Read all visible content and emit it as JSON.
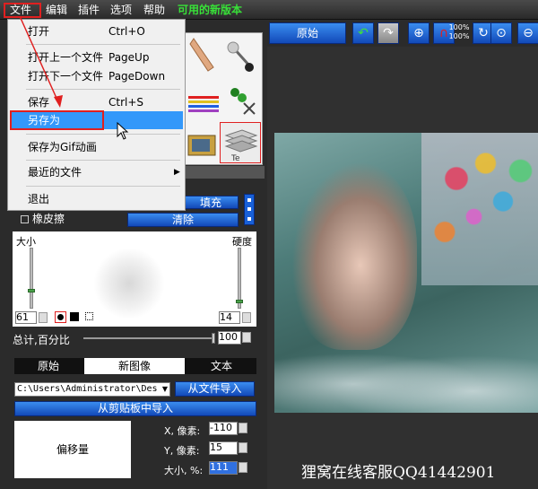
{
  "menubar": {
    "items": [
      "文件",
      "编辑",
      "插件",
      "选项",
      "帮助"
    ],
    "update_link": "可用的新版本"
  },
  "file_menu": {
    "open": {
      "label": "打开",
      "shortcut": "Ctrl+O"
    },
    "prev_file": {
      "label": "打开上一个文件",
      "shortcut": "PageUp"
    },
    "next_file": {
      "label": "打开下一个文件",
      "shortcut": "PageDown"
    },
    "save": {
      "label": "保存",
      "shortcut": "Ctrl+S"
    },
    "save_as": {
      "label": "另存为"
    },
    "save_gif": {
      "label": "保存为Gif动画"
    },
    "recent": {
      "label": "最近的文件"
    },
    "exit": {
      "label": "退出"
    }
  },
  "brush": {
    "fill_label": "填充",
    "eraser_label": "橡皮擦",
    "clear_label": "清除",
    "size_label": "大小",
    "hardness_label": "硬度",
    "size_value": "61",
    "hardness_value": "14",
    "total_label": "总计,百分比",
    "total_value": "100"
  },
  "tabs": [
    "原始",
    "新图像",
    "文本"
  ],
  "import": {
    "path": "C:\\Users\\Administrator\\Des",
    "from_file": "从文件导入",
    "from_clipboard": "从剪贴板中导入"
  },
  "offset": {
    "box_label": "偏移量",
    "x_label": "X, 像素:",
    "x_value": "-110",
    "y_label": "Y, 像素:",
    "y_value": "15",
    "size_label": "大小, %:",
    "size_value": "111"
  },
  "toolbar": {
    "original_label": "原始",
    "zoom_label_top": "100%",
    "zoom_label_bottom": "100%"
  },
  "watermark": "狸窝在线客服QQ41442901"
}
